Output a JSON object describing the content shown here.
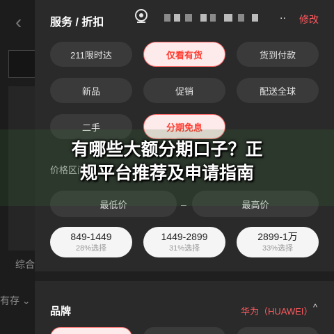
{
  "background": {
    "back_glyph": "‹",
    "text1": "综合",
    "text2": "有存 ⌄"
  },
  "header": {
    "title": "服务 / 折扣",
    "more": "..",
    "edit": "修改",
    "accent_color": "#ff5a5f"
  },
  "service_chips": [
    {
      "label": "211限时达",
      "active": false
    },
    {
      "label": "仅看有货",
      "active": true
    },
    {
      "label": "货到付款",
      "active": false
    },
    {
      "label": "新品",
      "active": false
    },
    {
      "label": "促销",
      "active": false
    },
    {
      "label": "配送全球",
      "active": false
    },
    {
      "label": "二手",
      "active": false
    },
    {
      "label": "分期免息",
      "active": true
    }
  ],
  "price": {
    "section_label": "价格区间",
    "min_placeholder": "最低价",
    "dash": "–",
    "max_placeholder": "最高价",
    "ranges": [
      {
        "range": "849-1449",
        "percent": "28%选择"
      },
      {
        "range": "1449-2899",
        "percent": "31%选择"
      },
      {
        "range": "2899-1万",
        "percent": "33%选择"
      }
    ]
  },
  "brand": {
    "title": "品牌",
    "selected": "华为（HUAWEI）",
    "chevron": "^"
  },
  "overlay": {
    "line1": "有哪些大额分期口子？正",
    "line2": "规平台推荐及申请指南"
  }
}
